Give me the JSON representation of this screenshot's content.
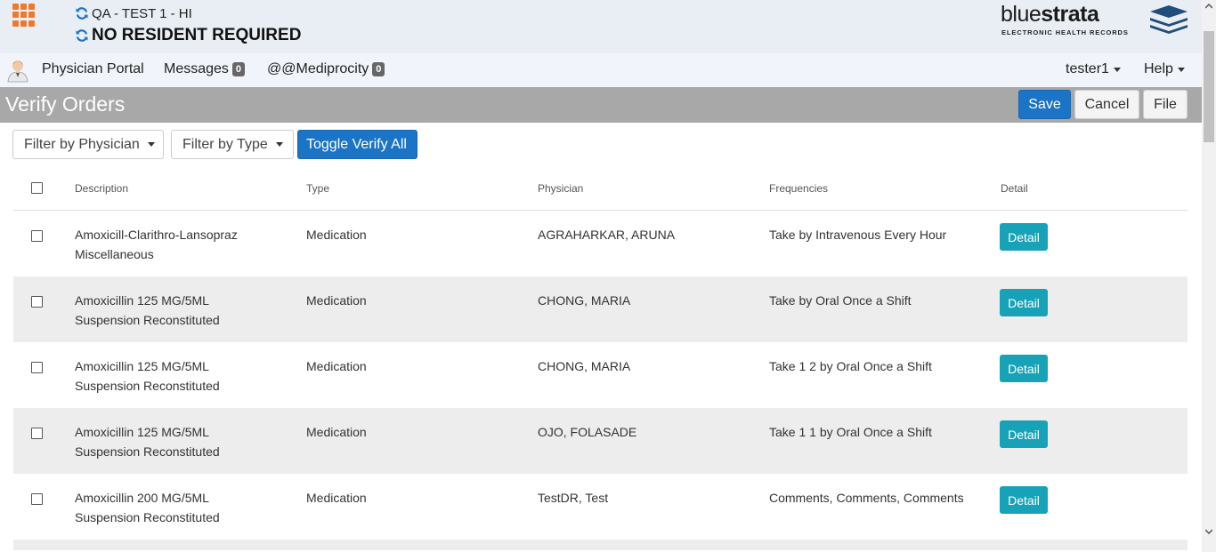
{
  "header": {
    "context_line": "QA - TEST 1 - HI",
    "resident_line": "NO RESIDENT REQUIRED",
    "logo_word_light": "blue",
    "logo_word_bold": "strata",
    "logo_subtitle": "ELECTRONIC HEALTH RECORDS"
  },
  "nav": {
    "physician_portal": "Physician Portal",
    "messages": "Messages",
    "messages_count": "0",
    "mediprocity": "@@Mediprocity",
    "mediprocity_count": "0",
    "user": "tester1",
    "help": "Help"
  },
  "page": {
    "title": "Verify Orders",
    "save": "Save",
    "cancel": "Cancel",
    "file": "File"
  },
  "filters": {
    "physician": "Filter by Physician",
    "type": "Filter by Type",
    "toggle": "Toggle Verify All"
  },
  "table": {
    "columns": [
      "Description",
      "Type",
      "Physician",
      "Frequencies",
      "Detail"
    ],
    "detail_label": "Detail",
    "rows": [
      {
        "desc1": "Amoxicill-Clarithro-Lansopraz",
        "desc2": "Miscellaneous",
        "type": "Medication",
        "physician": "AGRAHARKAR, ARUNA",
        "freq": "Take by Intravenous Every Hour"
      },
      {
        "desc1": "Amoxicillin 125 MG/5ML",
        "desc2": "Suspension Reconstituted",
        "type": "Medication",
        "physician": "CHONG, MARIA",
        "freq": "Take by Oral Once a Shift"
      },
      {
        "desc1": "Amoxicillin 125 MG/5ML",
        "desc2": "Suspension Reconstituted",
        "type": "Medication",
        "physician": "CHONG, MARIA",
        "freq": "Take 1 2 by Oral Once a Shift"
      },
      {
        "desc1": "Amoxicillin 125 MG/5ML",
        "desc2": "Suspension Reconstituted",
        "type": "Medication",
        "physician": "OJO, FOLASADE",
        "freq": "Take 1 1 by Oral Once a Shift"
      },
      {
        "desc1": "Amoxicillin 200 MG/5ML",
        "desc2": "Suspension Reconstituted",
        "type": "Medication",
        "physician": "TestDR, Test",
        "freq": "Comments, Comments, Comments"
      }
    ]
  },
  "colors": {
    "primary": "#1b74c5",
    "detail": "#17a2b8",
    "app_grid": "#f0782a",
    "header_bar": "#a8a8a8"
  }
}
